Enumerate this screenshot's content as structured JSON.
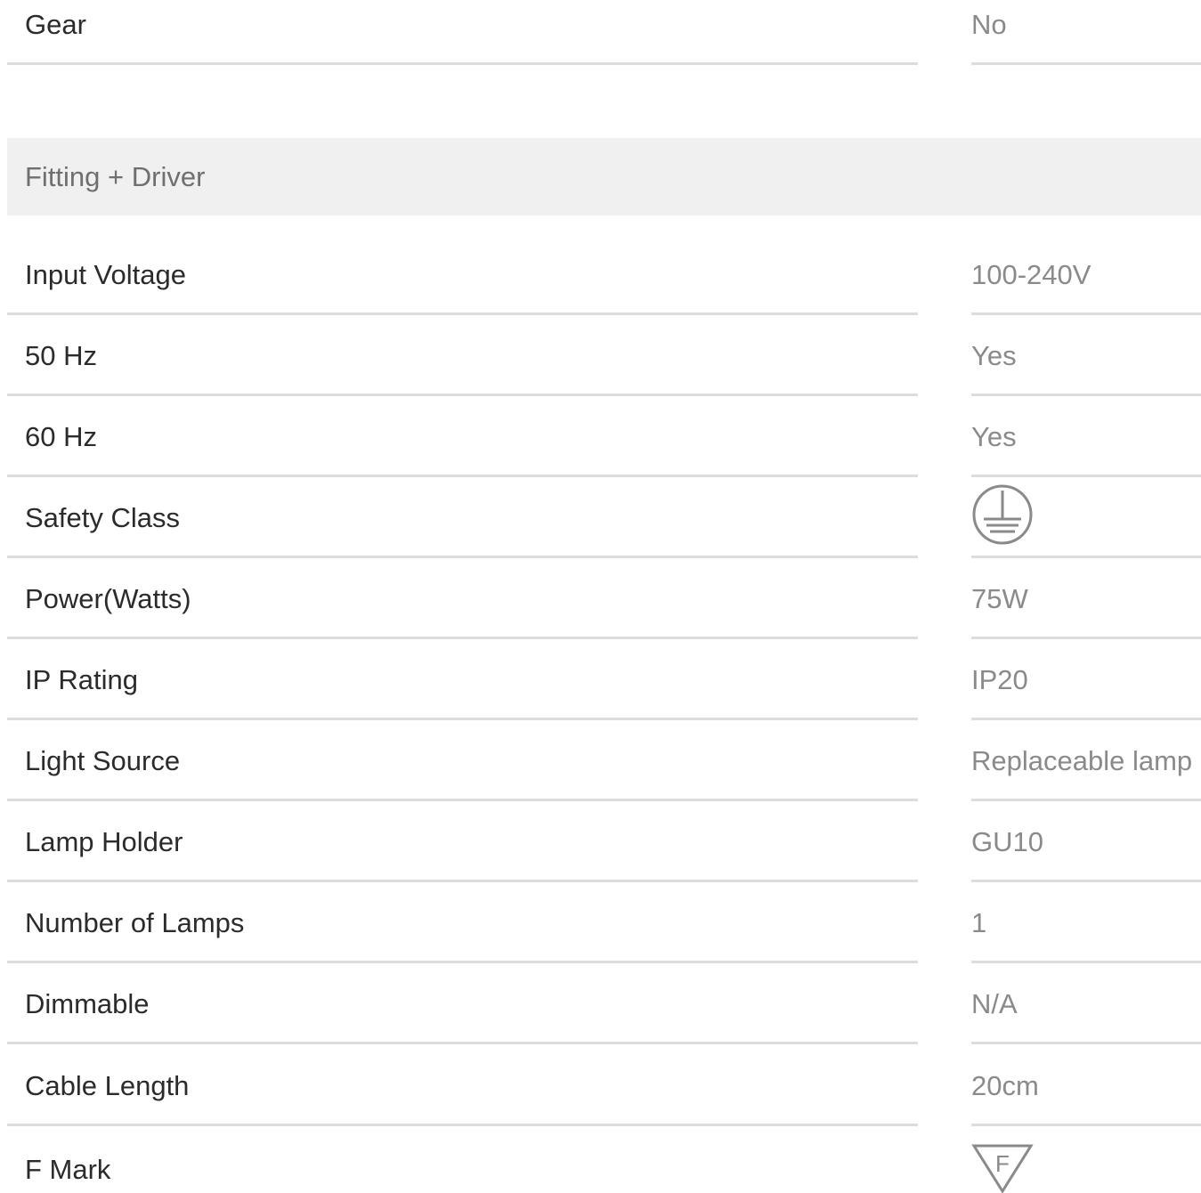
{
  "gear_row": {
    "label": "Gear",
    "value": "No"
  },
  "section": {
    "title": "Fitting + Driver"
  },
  "rows": [
    {
      "label": "Input Voltage",
      "value": "100-240V"
    },
    {
      "label": "50 Hz",
      "value": "Yes"
    },
    {
      "label": "60 Hz",
      "value": "Yes"
    },
    {
      "label": "Safety Class",
      "icon": "earth-ground-class-1-icon"
    },
    {
      "label": "Power(Watts)",
      "value": "75W"
    },
    {
      "label": "IP Rating",
      "value": "IP20"
    },
    {
      "label": "Light Source",
      "value": "Replaceable lamp"
    },
    {
      "label": "Lamp Holder",
      "value": "GU10"
    },
    {
      "label": "Number of Lamps",
      "value": "1"
    },
    {
      "label": "Dimmable",
      "value": "N/A"
    },
    {
      "label": "Cable Length",
      "value": "20cm"
    },
    {
      "label": "F Mark",
      "icon": "f-mark-triangle-icon",
      "icon_text": "F"
    }
  ],
  "colors": {
    "label_text": "#2b2b2b",
    "value_text": "#8a8a8a",
    "divider": "#dcdcdc",
    "section_bg": "#f0f0f0",
    "section_text": "#6f6f6f"
  }
}
